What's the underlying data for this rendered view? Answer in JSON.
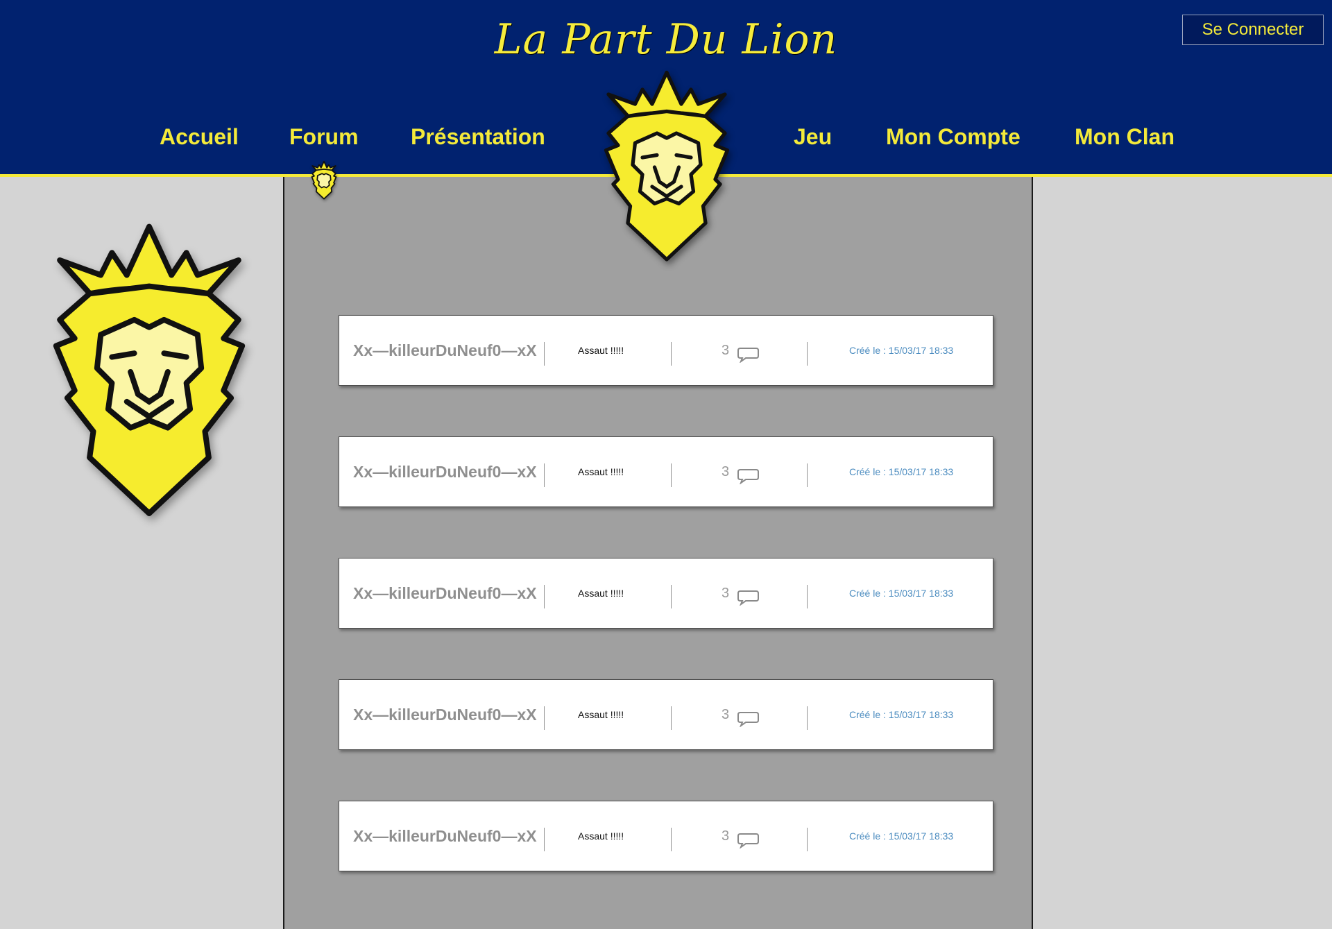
{
  "site": {
    "brand": "La Part Du Lion",
    "login_label": "Se Connecter"
  },
  "nav": {
    "items": [
      {
        "label": "Accueil"
      },
      {
        "label": "Forum",
        "active": true
      },
      {
        "label": "Présentation"
      },
      {
        "label": "Jeu"
      },
      {
        "label": "Mon Compte"
      },
      {
        "label": "Mon Clan"
      }
    ]
  },
  "icons": {
    "logo": "lion-crest-icon",
    "comment": "speech-bubble-icon",
    "active_marker": "small-lion-crest-icon"
  },
  "colors": {
    "header_bg": "#01226f",
    "accent_yellow": "#f4ea3a",
    "panel_gray": "#a0a0a0",
    "page_bg": "#d4d4d4",
    "date_blue": "#4a8bbf"
  },
  "topics": [
    {
      "author": "Xx—killeurDuNeuf0—xX",
      "title": "Assaut !!!!!",
      "comments": "3",
      "created": "Créé le : 15/03/17 18:33"
    },
    {
      "author": "Xx—killeurDuNeuf0—xX",
      "title": "Assaut !!!!!",
      "comments": "3",
      "created": "Créé le : 15/03/17 18:33"
    },
    {
      "author": "Xx—killeurDuNeuf0—xX",
      "title": "Assaut !!!!!",
      "comments": "3",
      "created": "Créé le : 15/03/17 18:33"
    },
    {
      "author": "Xx—killeurDuNeuf0—xX",
      "title": "Assaut !!!!!",
      "comments": "3",
      "created": "Créé le : 15/03/17 18:33"
    },
    {
      "author": "Xx—killeurDuNeuf0—xX",
      "title": "Assaut !!!!!",
      "comments": "3",
      "created": "Créé le : 15/03/17 18:33"
    }
  ]
}
